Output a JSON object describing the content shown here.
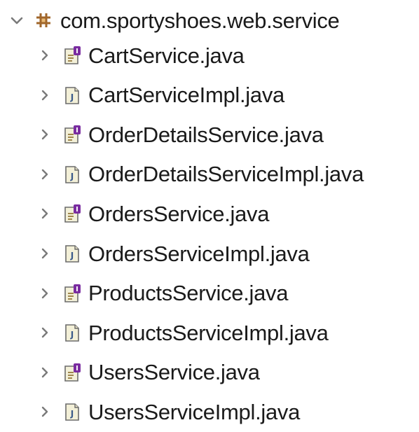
{
  "package": {
    "label": "com.sportyshoes.web.service",
    "expanded": true,
    "icon": "package-icon"
  },
  "items": [
    {
      "label": "CartService.java",
      "kind": "interface",
      "icon": "java-interface-icon"
    },
    {
      "label": "CartServiceImpl.java",
      "kind": "class",
      "icon": "java-class-icon"
    },
    {
      "label": "OrderDetailsService.java",
      "kind": "interface",
      "icon": "java-interface-icon"
    },
    {
      "label": "OrderDetailsServiceImpl.java",
      "kind": "class",
      "icon": "java-class-icon"
    },
    {
      "label": "OrdersService.java",
      "kind": "interface",
      "icon": "java-interface-icon"
    },
    {
      "label": "OrdersServiceImpl.java",
      "kind": "class",
      "icon": "java-class-icon"
    },
    {
      "label": "ProductsService.java",
      "kind": "interface",
      "icon": "java-interface-icon"
    },
    {
      "label": "ProductsServiceImpl.java",
      "kind": "class",
      "icon": "java-class-icon"
    },
    {
      "label": "UsersService.java",
      "kind": "interface",
      "icon": "java-interface-icon"
    },
    {
      "label": "UsersServiceImpl.java",
      "kind": "class",
      "icon": "java-class-icon"
    }
  ],
  "colors": {
    "twisty": "#7a7a7a",
    "package_icon": "#a0662a",
    "interface_badge": "#7a2ca0",
    "file_outline": "#6b6b6b",
    "file_fill": "#f3f0d8"
  }
}
